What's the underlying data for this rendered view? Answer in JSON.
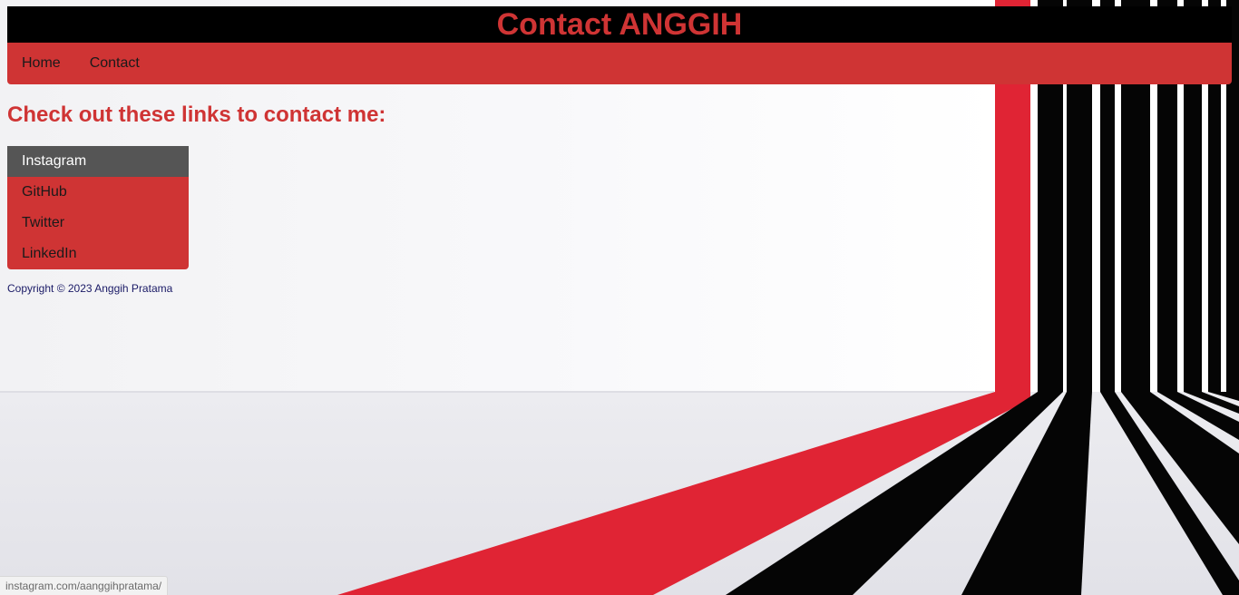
{
  "header": {
    "title": "Contact ANGGIH"
  },
  "nav": {
    "items": [
      {
        "label": "Home"
      },
      {
        "label": "Contact"
      }
    ]
  },
  "main": {
    "heading": "Check out these links to contact me:",
    "links": [
      {
        "label": "Instagram",
        "hovered": true
      },
      {
        "label": "GitHub"
      },
      {
        "label": "Twitter"
      },
      {
        "label": "LinkedIn"
      }
    ]
  },
  "footer": {
    "copyright": "Copyright © 2023 Anggih Pratama"
  },
  "status_bar": {
    "url": "instagram.com/aanggihpratama/"
  },
  "colors": {
    "accent_red": "#cf3434",
    "header_bg": "#000000",
    "hover_bg": "#555555",
    "stripe_red": "#e02434",
    "stripe_black": "#050505"
  }
}
